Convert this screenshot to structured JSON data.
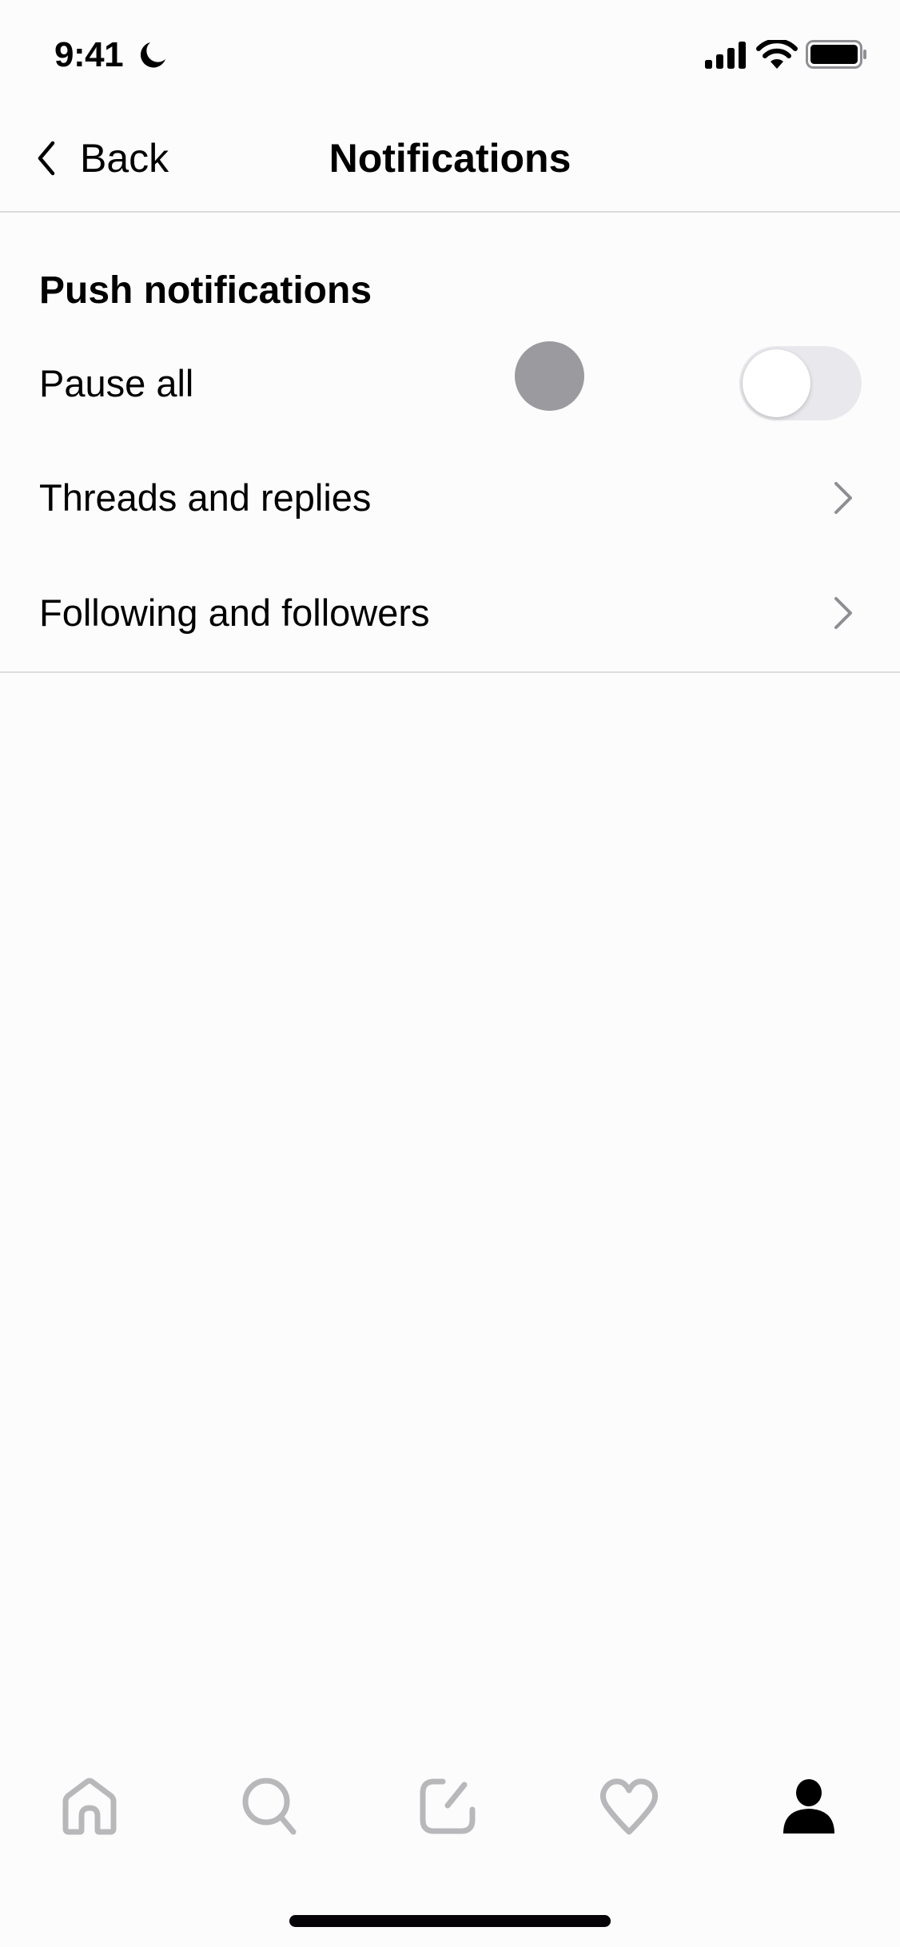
{
  "status_bar": {
    "time": "9:41",
    "focus_icon": "moon-icon",
    "icons": [
      "cellular-signal-icon",
      "wifi-icon",
      "battery-icon"
    ]
  },
  "nav": {
    "back_label": "Back",
    "back_icon": "chevron-left-icon",
    "title": "Notifications"
  },
  "section": {
    "title": "Push notifications",
    "rows": [
      {
        "label": "Pause all",
        "control": "toggle",
        "toggle_on": false
      },
      {
        "label": "Threads and replies",
        "control": "chevron-right-icon"
      },
      {
        "label": "Following and followers",
        "control": "chevron-right-icon"
      }
    ]
  },
  "tab_bar": {
    "tabs": [
      {
        "name": "home",
        "icon": "home-icon",
        "active": false
      },
      {
        "name": "search",
        "icon": "search-icon",
        "active": false
      },
      {
        "name": "compose",
        "icon": "compose-icon",
        "active": false
      },
      {
        "name": "activity",
        "icon": "heart-icon",
        "active": false
      },
      {
        "name": "profile",
        "icon": "profile-icon",
        "active": true
      }
    ]
  },
  "colors": {
    "background": "#fdfcfd",
    "text": "#000000",
    "divider": "#dcdbdd",
    "chevron": "#8e8d92",
    "inactive_tab": "#b8b7ba",
    "active_tab": "#000000",
    "toggle_off_track": "#e9e8ec",
    "touch_indicator": "#9b9a9e"
  }
}
